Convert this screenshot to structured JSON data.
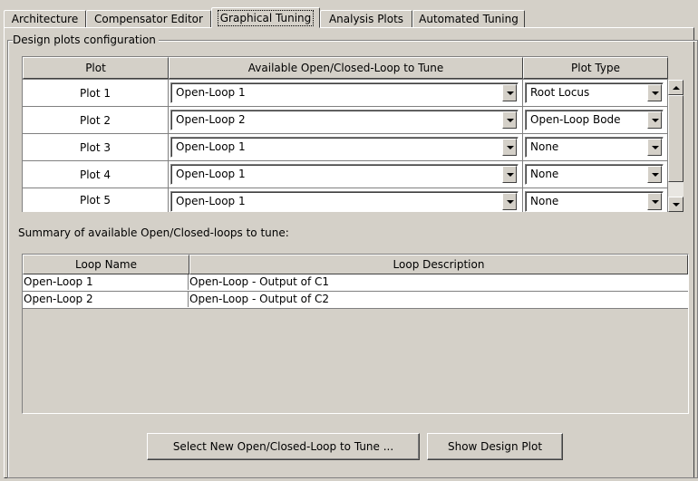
{
  "tabs": [
    {
      "label": "Architecture",
      "active": false
    },
    {
      "label": "Compensator Editor",
      "active": false
    },
    {
      "label": "Graphical Tuning",
      "active": true
    },
    {
      "label": "Analysis Plots",
      "active": false
    },
    {
      "label": "Automated Tuning",
      "active": false
    }
  ],
  "design": {
    "group_title": "Design plots configuration",
    "headers": {
      "plot": "Plot",
      "loop": "Available Open/Closed-Loop to Tune",
      "type": "Plot Type"
    },
    "rows": [
      {
        "plot": "Plot 1",
        "loop": "Open-Loop 1",
        "type": "Root Locus"
      },
      {
        "plot": "Plot 2",
        "loop": "Open-Loop 2",
        "type": "Open-Loop Bode"
      },
      {
        "plot": "Plot 3",
        "loop": "Open-Loop 1",
        "type": "None"
      },
      {
        "plot": "Plot 4",
        "loop": "Open-Loop 1",
        "type": "None"
      },
      {
        "plot": "Plot 5",
        "loop": "Open-Loop 1",
        "type": "None"
      }
    ]
  },
  "summary": {
    "label": "Summary of available Open/Closed-loops to tune:",
    "headers": {
      "name": "Loop Name",
      "description": "Loop Description"
    },
    "rows": [
      {
        "name": "Open-Loop 1",
        "description": "Open-Loop - Output of C1"
      },
      {
        "name": "Open-Loop 2",
        "description": "Open-Loop - Output of C2"
      }
    ]
  },
  "buttons": {
    "select_new": "Select New Open/Closed-Loop to Tune ...",
    "show_plot": "Show Design Plot"
  }
}
